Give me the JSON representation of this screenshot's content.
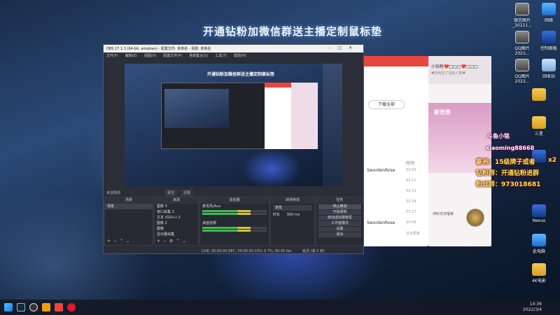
{
  "banner": "开通钻粉加微信群送主播定制鼠标垫",
  "desktop_icons": [
    {
      "label": "微信图片_20221...",
      "kind": "photo"
    },
    {
      "label": "网络",
      "kind": "pc"
    },
    {
      "label": "QQ图片2021...",
      "kind": "photo"
    },
    {
      "label": "控制面板",
      "kind": "app"
    },
    {
      "label": "QQ图片2022...",
      "kind": "photo"
    },
    {
      "label": "回收站",
      "kind": "bin"
    },
    {
      "label": "",
      "kind": "folder"
    },
    {
      "label": "三星",
      "kind": "folder"
    },
    {
      "label": "",
      "kind": "app"
    },
    {
      "label": "Nexus",
      "kind": "app"
    },
    {
      "label": "此电脑",
      "kind": "pc"
    },
    {
      "label": "4K电影",
      "kind": "folder"
    }
  ],
  "taskbar": {
    "time": "14:36",
    "date": "2022/3/4",
    "apps": [
      "windows-icon",
      "steam-icon",
      "obs-icon",
      "app-icon",
      "live-icon",
      "weibo-icon"
    ]
  },
  "bg_window": {
    "button": "下载全部",
    "column": "时间",
    "rows": [
      {
        "name": "SwordenRose",
        "time": "02:03"
      },
      {
        "name": "",
        "time": "02:11"
      },
      {
        "name": "",
        "time": "02:19"
      },
      {
        "name": "",
        "time": "02:34"
      },
      {
        "name": "",
        "time": "07:17"
      },
      {
        "name": "SwordenRose",
        "time": "03:06"
      },
      {
        "name": "",
        "time": "近日更新"
      }
    ]
  },
  "live_window": {
    "header": "小钻粉❤️□□□❤️□□□",
    "sub": "♥粉粉进了钻粉人数♥",
    "banner": "彩世界",
    "line": "帅好无法唱歌"
  },
  "overlays": {
    "douyu": "斗鱼小铭",
    "handle": "xiaoming88668",
    "rich": "豪爸：15级牌子或者",
    "x2": "x2",
    "group": "钻粉群：开通钻粉进群",
    "fans": "粉丝群：973018681"
  },
  "obs": {
    "title": "OBS 27.1.3 (64-bit, windows) - 配置文件: 未命名 - 场景: 未命名",
    "menus": [
      "文件(F)",
      "编辑(E)",
      "视图(V)",
      "配置文件(P)",
      "场景集合(S)",
      "工具(T)",
      "帮助(H)"
    ],
    "preview_title": "开通钻粉加微信群送主播定制鼠标垫",
    "bar": {
      "source_label": "未选择源",
      "filter": "属性",
      "prop": "滤镜"
    },
    "docks": {
      "scenes": {
        "title": "场景",
        "items": [
          "场景"
        ]
      },
      "sources": {
        "title": "来源",
        "items": [
          "图像 3",
          "窗口采集 2",
          "文本 (GDI+) 2",
          "图像 2",
          "图像",
          "显示器采集"
        ]
      },
      "mixer": {
        "title": "混音器",
        "items": [
          "麦克风/Aux",
          "桌面音频"
        ]
      },
      "transitions": {
        "title": "转场特效",
        "fade": "渐变",
        "duration_label": "时长",
        "duration": "300 ms"
      },
      "controls": {
        "title": "控件",
        "items": [
          "停止推流",
          "开始录制",
          "启动虚拟摄像机",
          "工作室模式",
          "设置",
          "退出"
        ]
      }
    },
    "status": "LIVE: 00:00:00    REC: 00:00:00    CPU: 0.7%, 60.00 fps",
    "status_end": "延迟 (丢 0 帧)"
  }
}
